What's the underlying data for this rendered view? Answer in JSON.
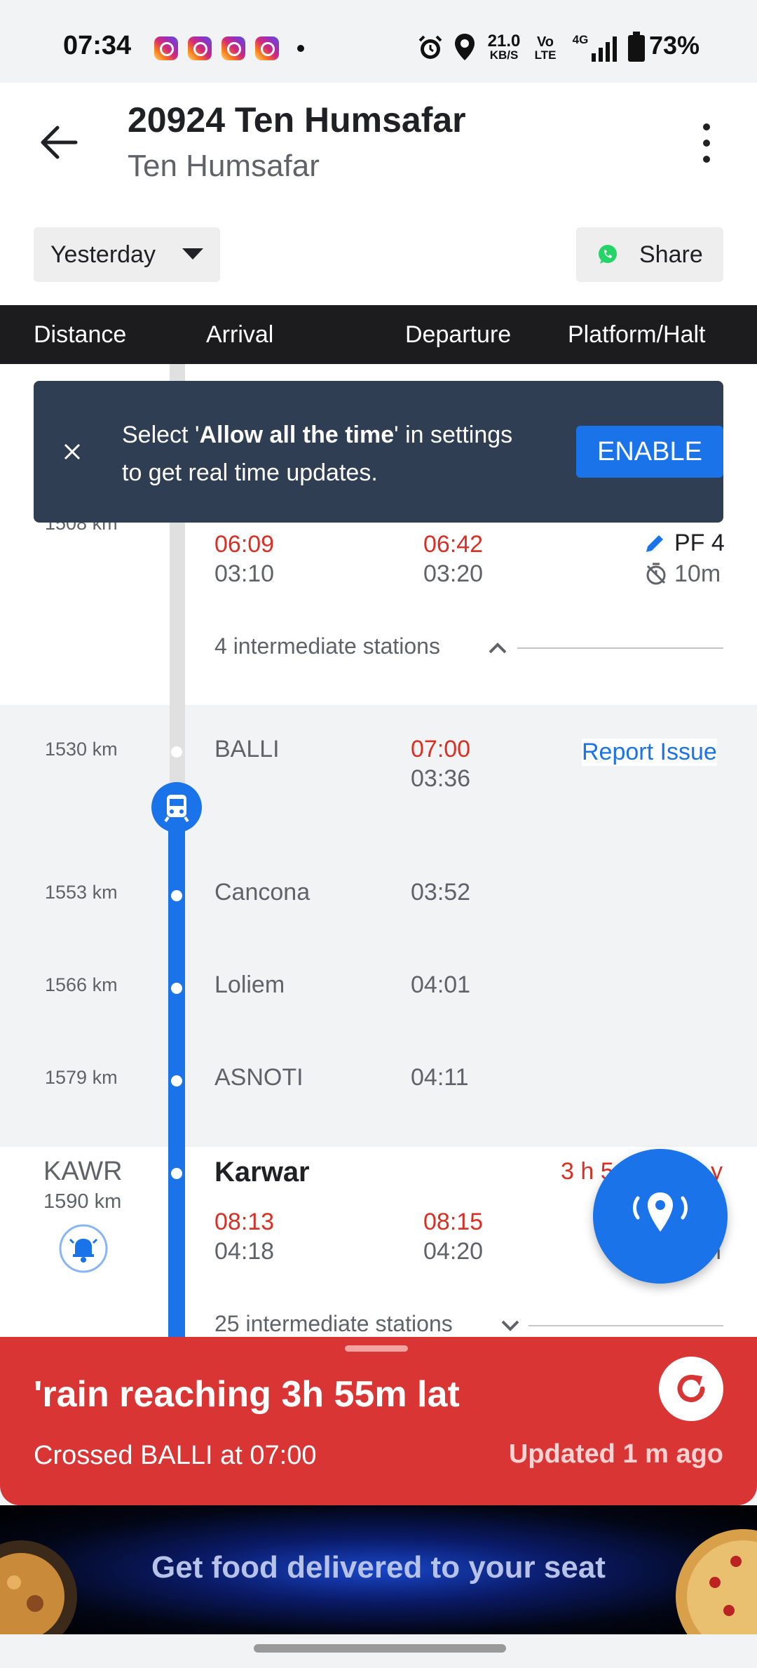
{
  "status_bar": {
    "time": "07:34",
    "speed_value": "21.0",
    "speed_unit": "KB/S",
    "volte_top": "Vo",
    "volte_bottom": "LTE",
    "network": "4G",
    "battery": "73%"
  },
  "header": {
    "title": "20924 Ten Humsafar",
    "subtitle": "Ten Humsafar",
    "day_selector": "Yesterday",
    "share_label": "Share"
  },
  "columns": [
    "Distance",
    "Arrival",
    "Departure",
    "Platform/Halt"
  ],
  "snackbar": {
    "text_pre": "Select '",
    "text_bold": "Allow all the time",
    "text_post": "' in settings to get real time updates.",
    "button": "ENABLE"
  },
  "stop_top": {
    "distance": "1508 km",
    "arr_actual": "06:09",
    "arr_sched": "03:10",
    "dep_actual": "06:42",
    "dep_sched": "03:20",
    "platform": "PF 4",
    "halt": "10m"
  },
  "intermediate_top": "4 intermediate stations",
  "stations": [
    {
      "distance": "1530 km",
      "name": "BALLI",
      "time_actual": "07:00",
      "time": "03:36"
    },
    {
      "distance": "1553 km",
      "name": "Cancona",
      "time": "03:52"
    },
    {
      "distance": "1566 km",
      "name": "Loliem",
      "time": "04:01"
    },
    {
      "distance": "1579 km",
      "name": "ASNOTI",
      "time": "04:11"
    }
  ],
  "report_issue": "Report Issue",
  "karwar": {
    "code": "KAWR",
    "distance": "1590 km",
    "name": "Karwar",
    "delay": "3 h 5",
    "delay_tail": "y",
    "arr_actual": "08:13",
    "arr_sched": "04:18",
    "dep_actual": "08:15",
    "dep_sched": "04:20",
    "halt_tail": "n"
  },
  "intermediate_bottom": "25 intermediate stations",
  "bottom_sheet": {
    "headline": "'rain reaching 3h 55m lat",
    "crossed": "Crossed BALLI at 07:00",
    "updated": "Updated 1 m  ago"
  },
  "ad": {
    "text": "Get food delivered to your seat"
  },
  "colors": {
    "accent": "#1a73e8",
    "late": "#d93025",
    "sheet": "#d93535",
    "snackbar": "#2f3e52"
  }
}
